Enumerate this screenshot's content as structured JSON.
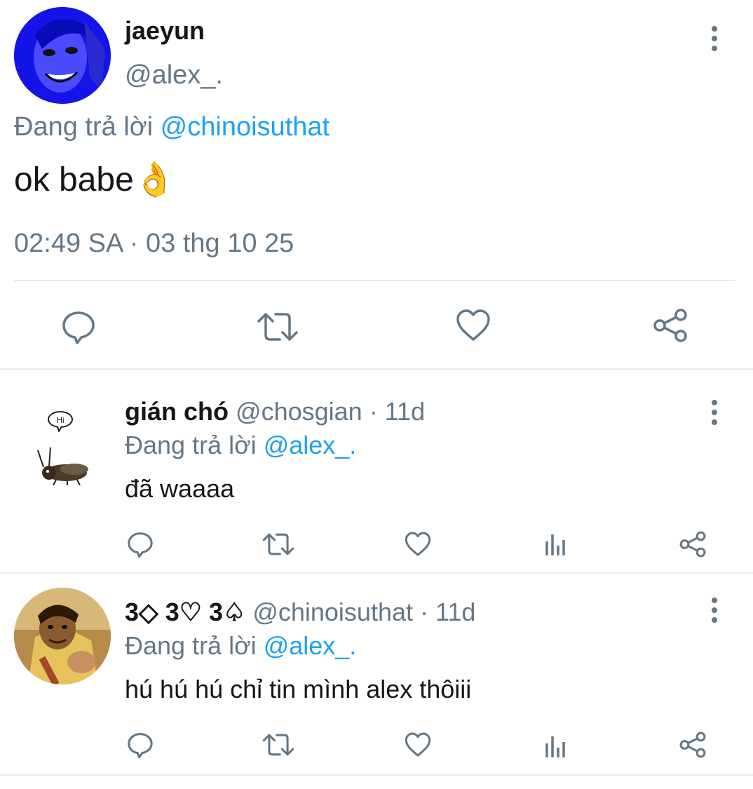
{
  "main_tweet": {
    "display_name": "jaeyun",
    "handle": "@alex_.",
    "reply_prefix": "Đang trả lời",
    "reply_to": "@chinoisuthat",
    "text": "ok babe",
    "emoji": "👌",
    "timestamp": "02:49 SA · 03 thg 10 25",
    "avatar_color": "#1a1aff"
  },
  "replies": [
    {
      "display_name": "gián chó",
      "handle": "@chosgian",
      "age": "· 11d",
      "reply_prefix": "Đang trả lời",
      "reply_to": "@alex_.",
      "text": "đã waaaa",
      "avatar_bubble_text": "Hi"
    },
    {
      "display_name": "3◇ 3♡ 3♤",
      "handle": "@chinoisuthat",
      "age": "· 11d",
      "reply_prefix": "Đang trả lời",
      "reply_to": "@alex_.",
      "text": "hú hú hú chỉ tin mình alex thôiii"
    }
  ],
  "icons": {
    "reply": "reply-icon",
    "retweet": "retweet-icon",
    "like": "heart-icon",
    "views": "views-icon",
    "share": "share-icon",
    "more": "more-vertical-icon"
  },
  "colors": {
    "link": "#1da1f2",
    "muted": "#657786",
    "divider": "#e6ecf0"
  }
}
